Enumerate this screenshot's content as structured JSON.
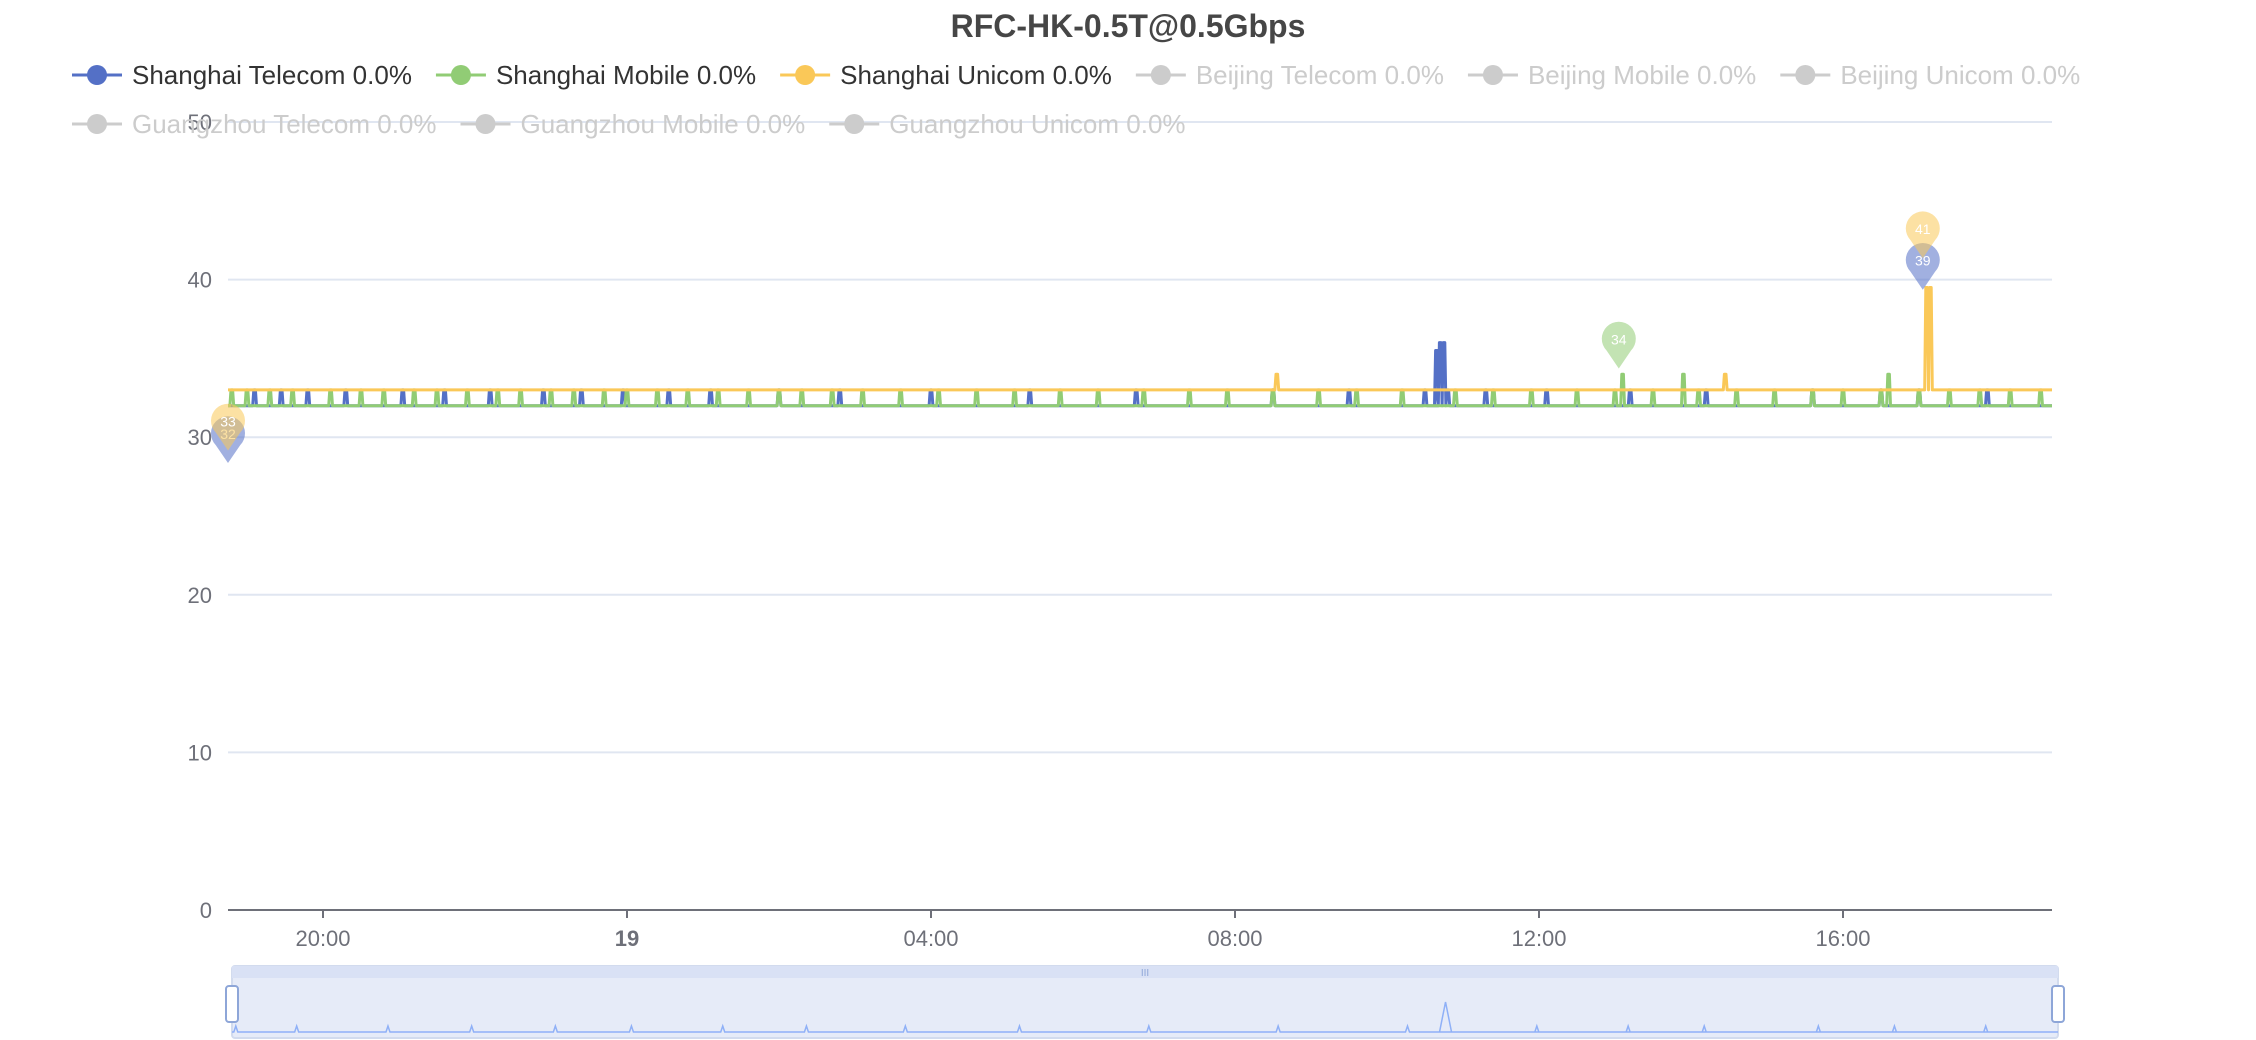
{
  "chart_data": {
    "type": "line",
    "title": "RFC-HK-0.5T@0.5Gbps",
    "ylim": [
      0,
      50
    ],
    "yticks": [
      "0",
      "10",
      "20",
      "30",
      "40",
      "50"
    ],
    "xlim_hours": [
      18.75,
      42.75
    ],
    "xticks": [
      {
        "label": "20:00",
        "value": 20,
        "bold": false
      },
      {
        "label": "19",
        "value": 24,
        "bold": true
      },
      {
        "label": "04:00",
        "value": 28,
        "bold": false
      },
      {
        "label": "08:00",
        "value": 32,
        "bold": false
      },
      {
        "label": "12:00",
        "value": 36,
        "bold": false
      },
      {
        "label": "16:00",
        "value": 40,
        "bold": false
      }
    ],
    "grid": true,
    "legend_position": "top",
    "series": [
      {
        "name": "Shanghai Telecom 0.0%",
        "color": "#5470c6",
        "active": true,
        "baseline": 32,
        "spikes": [
          [
            19.1,
            33
          ],
          [
            19.45,
            33
          ],
          [
            19.8,
            33
          ],
          [
            20.3,
            33
          ],
          [
            21.05,
            33
          ],
          [
            21.6,
            33
          ],
          [
            22.2,
            33
          ],
          [
            22.9,
            33
          ],
          [
            23.4,
            33
          ],
          [
            23.95,
            33
          ],
          [
            24.55,
            33
          ],
          [
            25.1,
            33
          ],
          [
            26.0,
            33
          ],
          [
            26.8,
            33
          ],
          [
            28.0,
            33
          ],
          [
            29.3,
            33
          ],
          [
            30.7,
            33
          ],
          [
            32.5,
            33
          ],
          [
            33.5,
            33
          ],
          [
            34.5,
            33
          ],
          [
            34.65,
            33
          ],
          [
            34.65,
            35.5
          ],
          [
            34.7,
            36
          ],
          [
            34.75,
            36
          ],
          [
            34.8,
            33
          ],
          [
            35.3,
            33
          ],
          [
            36.1,
            33
          ],
          [
            37.2,
            33
          ],
          [
            38.2,
            33
          ],
          [
            39.6,
            33
          ],
          [
            40.5,
            33
          ],
          [
            41.0,
            33
          ],
          [
            41.9,
            33
          ]
        ],
        "markers": [
          {
            "label": "32",
            "x": 18.75,
            "y": 30.2,
            "kind": "min"
          },
          {
            "label": "39",
            "x": 41.05,
            "y": 41.2,
            "kind": "max"
          }
        ]
      },
      {
        "name": "Shanghai Mobile 0.0%",
        "color": "#91cc75",
        "active": true,
        "baseline": 32,
        "spikes": [
          [
            18.8,
            33
          ],
          [
            19.0,
            33
          ],
          [
            19.3,
            33
          ],
          [
            19.6,
            33
          ],
          [
            20.1,
            33
          ],
          [
            20.5,
            33
          ],
          [
            20.8,
            33
          ],
          [
            21.2,
            33
          ],
          [
            21.5,
            33
          ],
          [
            21.9,
            33
          ],
          [
            22.3,
            33
          ],
          [
            22.6,
            33
          ],
          [
            23.0,
            33
          ],
          [
            23.3,
            33
          ],
          [
            23.7,
            33
          ],
          [
            24.0,
            33
          ],
          [
            24.4,
            33
          ],
          [
            24.8,
            33
          ],
          [
            25.2,
            33
          ],
          [
            25.6,
            33
          ],
          [
            26.0,
            33
          ],
          [
            26.3,
            33
          ],
          [
            26.7,
            33
          ],
          [
            27.1,
            33
          ],
          [
            27.6,
            33
          ],
          [
            28.1,
            33
          ],
          [
            28.6,
            33
          ],
          [
            29.1,
            33
          ],
          [
            29.7,
            33
          ],
          [
            30.2,
            33
          ],
          [
            30.8,
            33
          ],
          [
            31.4,
            33
          ],
          [
            31.9,
            33
          ],
          [
            32.5,
            33
          ],
          [
            33.1,
            33
          ],
          [
            33.6,
            33
          ],
          [
            34.2,
            33
          ],
          [
            34.9,
            33
          ],
          [
            35.4,
            33
          ],
          [
            35.9,
            33
          ],
          [
            36.5,
            33
          ],
          [
            37.0,
            33
          ],
          [
            37.1,
            34
          ],
          [
            37.5,
            33
          ],
          [
            37.9,
            34
          ],
          [
            38.1,
            33
          ],
          [
            38.6,
            33
          ],
          [
            39.1,
            33
          ],
          [
            39.6,
            33
          ],
          [
            40.0,
            33
          ],
          [
            40.5,
            33
          ],
          [
            40.6,
            34
          ],
          [
            41.0,
            33
          ],
          [
            41.4,
            33
          ],
          [
            41.8,
            33
          ],
          [
            42.2,
            33
          ],
          [
            42.6,
            33
          ]
        ],
        "markers": [
          {
            "label": "34",
            "x": 37.05,
            "y": 36.2,
            "kind": "max"
          }
        ]
      },
      {
        "name": "Shanghai Unicom 0.0%",
        "color": "#fac858",
        "active": true,
        "baseline": 33,
        "spikes": [
          [
            32.55,
            34
          ],
          [
            38.45,
            34
          ],
          [
            41.05,
            33
          ],
          [
            41.1,
            39.5
          ],
          [
            41.15,
            39.5
          ],
          [
            41.2,
            33
          ]
        ],
        "markers": [
          {
            "label": "33",
            "x": 18.75,
            "y": 31.0,
            "kind": "min"
          },
          {
            "label": "41",
            "x": 41.05,
            "y": 43.2,
            "kind": "max"
          }
        ]
      },
      {
        "name": "Beijing Telecom 0.0%",
        "color": "#cccccc",
        "active": false
      },
      {
        "name": "Beijing Mobile 0.0%",
        "color": "#cccccc",
        "active": false
      },
      {
        "name": "Beijing Unicom 0.0%",
        "color": "#cccccc",
        "active": false
      },
      {
        "name": "Guangzhou Telecom 0.0%",
        "color": "#cccccc",
        "active": false
      },
      {
        "name": "Guangzhou Mobile 0.0%",
        "color": "#cccccc",
        "active": false
      },
      {
        "name": "Guangzhou Unicom 0.0%",
        "color": "#cccccc",
        "active": false
      }
    ],
    "data_zoom": {
      "start_percent": 0,
      "end_percent": 100,
      "handle_label": "III"
    }
  }
}
